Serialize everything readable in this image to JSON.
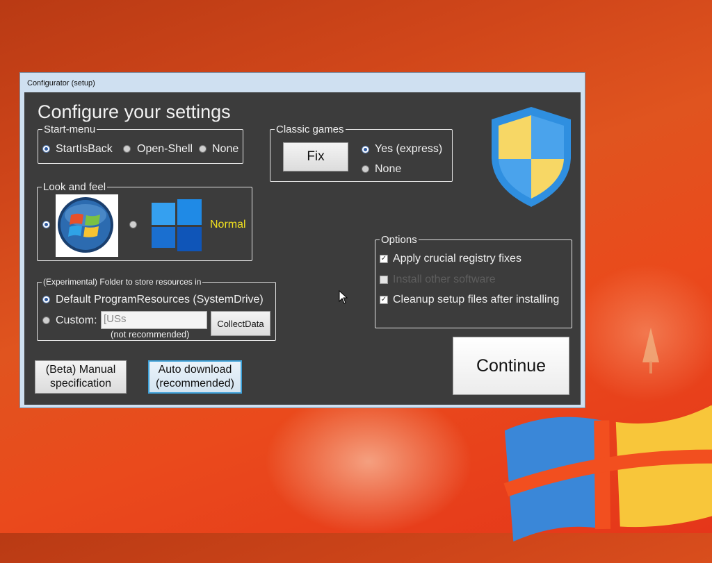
{
  "window": {
    "title": "Configurator (setup)",
    "heading": "Configure your settings"
  },
  "start_menu": {
    "legend": "Start-menu",
    "options": [
      {
        "label": "StartIsBack",
        "selected": true
      },
      {
        "label": "Open-Shell",
        "selected": false
      },
      {
        "label": "None",
        "selected": false
      }
    ]
  },
  "classic_games": {
    "legend": "Classic games",
    "fix_label": "Fix",
    "options": [
      {
        "label": "Yes (express)",
        "selected": true
      },
      {
        "label": "None",
        "selected": false
      }
    ]
  },
  "look_and_feel": {
    "legend": "Look and feel",
    "options": [
      {
        "icon": "windows-7-orb-icon",
        "selected": true
      },
      {
        "icon": "windows-11-logo-icon",
        "selected": false
      }
    ],
    "normal_label": "Normal",
    "normal_color": "#f0e020"
  },
  "resources": {
    "legend": "(Experimental) Folder to store resources in",
    "default_label": "Default ProgramResources (SystemDrive)",
    "default_selected": true,
    "custom_label": "Custom:",
    "custom_selected": false,
    "custom_value": "[USs",
    "not_recommended": "(not recommended)",
    "collect_button": "CollectData"
  },
  "options": {
    "legend": "Options",
    "items": [
      {
        "label": "Apply crucial registry fixes",
        "checked": true,
        "enabled": true
      },
      {
        "label": "Install other software",
        "checked": false,
        "enabled": false
      },
      {
        "label": "Cleanup setup files after installing",
        "checked": true,
        "enabled": true
      }
    ]
  },
  "buttons": {
    "manual": "(Beta) Manual specification",
    "auto": "Auto download (recommended)",
    "continue": "Continue"
  },
  "icons": {
    "shield": "uac-shield-icon",
    "cursor": "mouse-pointer-icon"
  },
  "colors": {
    "client_bg": "#3c3c3c",
    "shield_blue": "#2f8fe0",
    "shield_yellow": "#f7d765"
  }
}
